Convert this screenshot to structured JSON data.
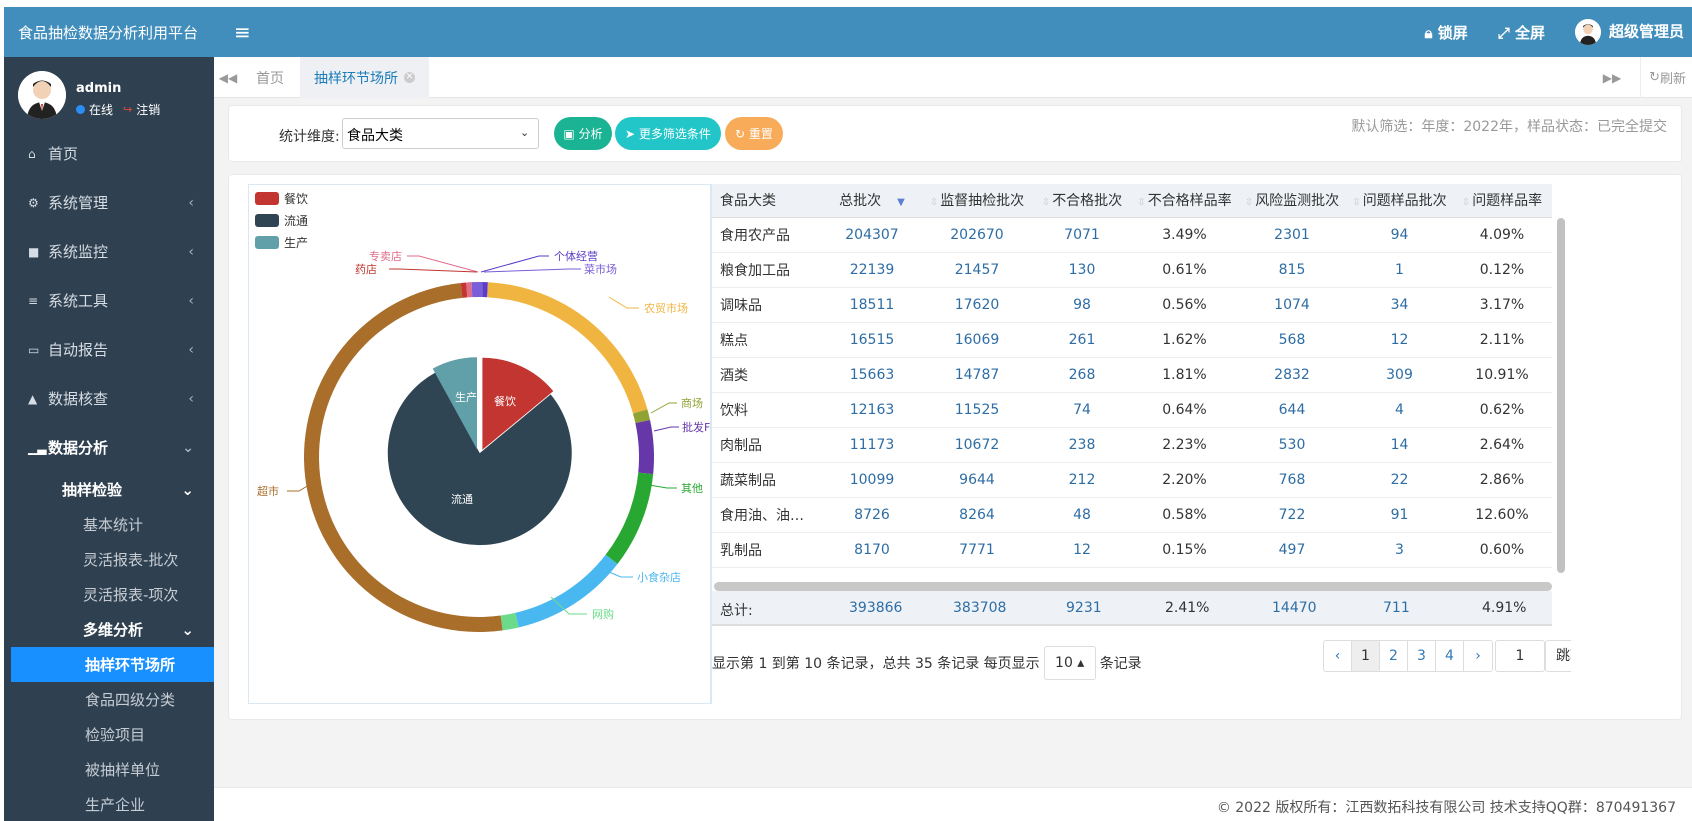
{
  "app_title": "食品抽检数据分析利用平台",
  "user": {
    "name": "admin",
    "status": "在线",
    "logout": "注销"
  },
  "header": {
    "lock": "锁屏",
    "fullscreen": "全屏",
    "admin": "超级管理员"
  },
  "sidebar": {
    "items": [
      {
        "label": "首页",
        "icon": "home-icon"
      },
      {
        "label": "系统管理",
        "icon": "gear-icon"
      },
      {
        "label": "系统监控",
        "icon": "video-icon"
      },
      {
        "label": "系统工具",
        "icon": "bars-icon"
      },
      {
        "label": "自动报告",
        "icon": "card-icon"
      },
      {
        "label": "数据核查",
        "icon": "warning-icon"
      },
      {
        "label": "数据分析",
        "icon": "bar-chart-icon"
      }
    ],
    "sub": {
      "sampling": "抽样检验",
      "basic": "基本统计",
      "flex_batch": "灵活报表-批次",
      "flex_item": "灵活报表-项次",
      "multi": "多维分析",
      "place": "抽样环节场所",
      "food4": "食品四级分类",
      "test_item": "检验项目",
      "sampled_unit": "被抽样单位",
      "producer": "生产企业"
    }
  },
  "tabs": {
    "home": "首页",
    "active": "抽样环节场所",
    "refresh": "刷新"
  },
  "filter": {
    "dim_label": "统计维度:",
    "dim_value": "食品大类",
    "analyze": "分析",
    "more": "更多筛选条件",
    "reset": "重置",
    "default_text": "默认筛选：年度：2022年，样品状态：已完全提交"
  },
  "chart_data": {
    "type": "pie",
    "legend": [
      "餐饮",
      "流通",
      "生产"
    ],
    "inner": [
      {
        "name": "餐饮",
        "value": 14
      },
      {
        "name": "流通",
        "value": 78
      },
      {
        "name": "生产",
        "value": 8
      }
    ],
    "outer": [
      {
        "name": "个体经营",
        "value": 0.5
      },
      {
        "name": "农贸市场",
        "value": 20
      },
      {
        "name": "商场",
        "value": 1
      },
      {
        "name": "批发市场",
        "value": 5
      },
      {
        "name": "其他",
        "value": 9
      },
      {
        "name": "小食杂店",
        "value": 11
      },
      {
        "name": "网购",
        "value": 1.5
      },
      {
        "name": "超市",
        "value": 51
      },
      {
        "name": "药店",
        "value": 0.5
      },
      {
        "name": "专卖店",
        "value": 0.5
      },
      {
        "name": "菜市场",
        "value": 1
      }
    ],
    "outer_labels": [
      "个体经营",
      "菜市场",
      "专卖店",
      "药店",
      "农贸市场",
      "商场",
      "批发F",
      "其他",
      "小食杂店",
      "网购",
      "超市"
    ],
    "colors": {
      "餐饮": "#c23531",
      "流通": "#2f4554",
      "生产": "#61a0a8",
      "农贸市场": "#f0b541",
      "商场": "#91a235",
      "批发市场": "#6637a9",
      "其他": "#28a832",
      "小食杂店": "#4ab8f0",
      "网购": "#6bdb8b",
      "超市": "#a86e2a",
      "个体经营": "#5a3cc8",
      "药店": "#c23531",
      "专卖店": "#e06d8a",
      "菜市场": "#7a5dd8"
    }
  },
  "table": {
    "headers": [
      "食品大类",
      "总批次",
      "监督抽检批次",
      "不合格批次",
      "不合格样品率",
      "风险监测批次",
      "问题样品批次",
      "问题样品率"
    ],
    "rows": [
      [
        "食用农产品",
        "204307",
        "202670",
        "7071",
        "3.49%",
        "2301",
        "94",
        "4.09%"
      ],
      [
        "粮食加工品",
        "22139",
        "21457",
        "130",
        "0.61%",
        "815",
        "1",
        "0.12%"
      ],
      [
        "调味品",
        "18511",
        "17620",
        "98",
        "0.56%",
        "1074",
        "34",
        "3.17%"
      ],
      [
        "糕点",
        "16515",
        "16069",
        "261",
        "1.62%",
        "568",
        "12",
        "2.11%"
      ],
      [
        "酒类",
        "15663",
        "14787",
        "268",
        "1.81%",
        "2832",
        "309",
        "10.91%"
      ],
      [
        "饮料",
        "12163",
        "11525",
        "74",
        "0.64%",
        "644",
        "4",
        "0.62%"
      ],
      [
        "肉制品",
        "11173",
        "10672",
        "238",
        "2.23%",
        "530",
        "14",
        "2.64%"
      ],
      [
        "蔬菜制品",
        "10099",
        "9644",
        "212",
        "2.20%",
        "768",
        "22",
        "2.86%"
      ],
      [
        "食用油、油…",
        "8726",
        "8264",
        "48",
        "0.58%",
        "722",
        "91",
        "12.60%"
      ],
      [
        "乳制品",
        "8170",
        "7771",
        "12",
        "0.15%",
        "497",
        "3",
        "0.60%"
      ]
    ],
    "total": [
      "总计:",
      "393866",
      "383708",
      "9231",
      "2.41%",
      "14470",
      "711",
      "4.91%"
    ]
  },
  "pager": {
    "info": "显示第 1 到第 10 条记录，总共 35 条记录 每页显示",
    "size": "10",
    "suffix": "条记录",
    "pages": [
      "‹",
      "1",
      "2",
      "3",
      "4",
      "›"
    ],
    "input": "1",
    "jump": "跳转"
  },
  "footer": "© 2022 版权所有：江西数拓科技有限公司 技术支持QQ群：870491367"
}
